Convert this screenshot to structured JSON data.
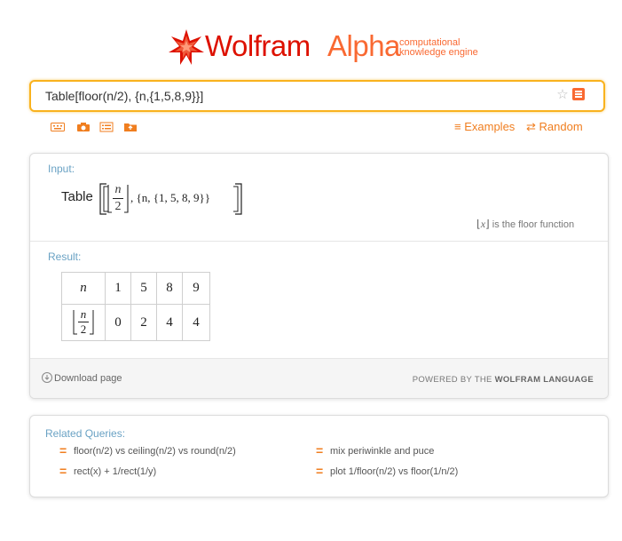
{
  "logo": {
    "wordmark_1": "Wolfram",
    "wordmark_2": "Alpha",
    "tagline_1": "computational",
    "tagline_2": "knowledge engine"
  },
  "search": {
    "value": "Table[floor(n/2), {n,{1,5,8,9}}]"
  },
  "toolbar": {
    "icons": [
      "keyboard-icon",
      "camera-icon",
      "list-icon",
      "folder-upload-icon"
    ],
    "examples_label": "Examples",
    "random_label": "Random"
  },
  "input_pod": {
    "title": "Input:",
    "table_word": "Table",
    "math": {
      "numerator": "n",
      "denominator": "2",
      "rest": ", {n, {1, 5, 8, 9}}"
    },
    "note_symbol": "x",
    "note_text": "is the floor function"
  },
  "result_pod": {
    "title": "Result:",
    "header": [
      "n",
      "1",
      "5",
      "8",
      "9"
    ],
    "row_label": {
      "numerator": "n",
      "denominator": "2"
    },
    "row_values": [
      "0",
      "2",
      "4",
      "4"
    ]
  },
  "footer": {
    "download_label": "Download page",
    "powered_prefix": "POWERED BY THE",
    "powered_brand": "WOLFRAM LANGUAGE"
  },
  "related": {
    "title": "Related Queries:",
    "items": [
      "floor(n/2) vs ceiling(n/2) vs round(n/2)",
      "mix periwinkle and puce",
      "rect(x) + 1/rect(1/y)",
      "plot 1/floor(n/2) vs floor(1/n/2)"
    ]
  },
  "colors": {
    "brand_red": "#dd1100",
    "brand_orange": "#f96932",
    "search_border": "#f9b21e",
    "link_orange": "#f07e1f",
    "pod_title_blue": "#6aa2c4"
  }
}
